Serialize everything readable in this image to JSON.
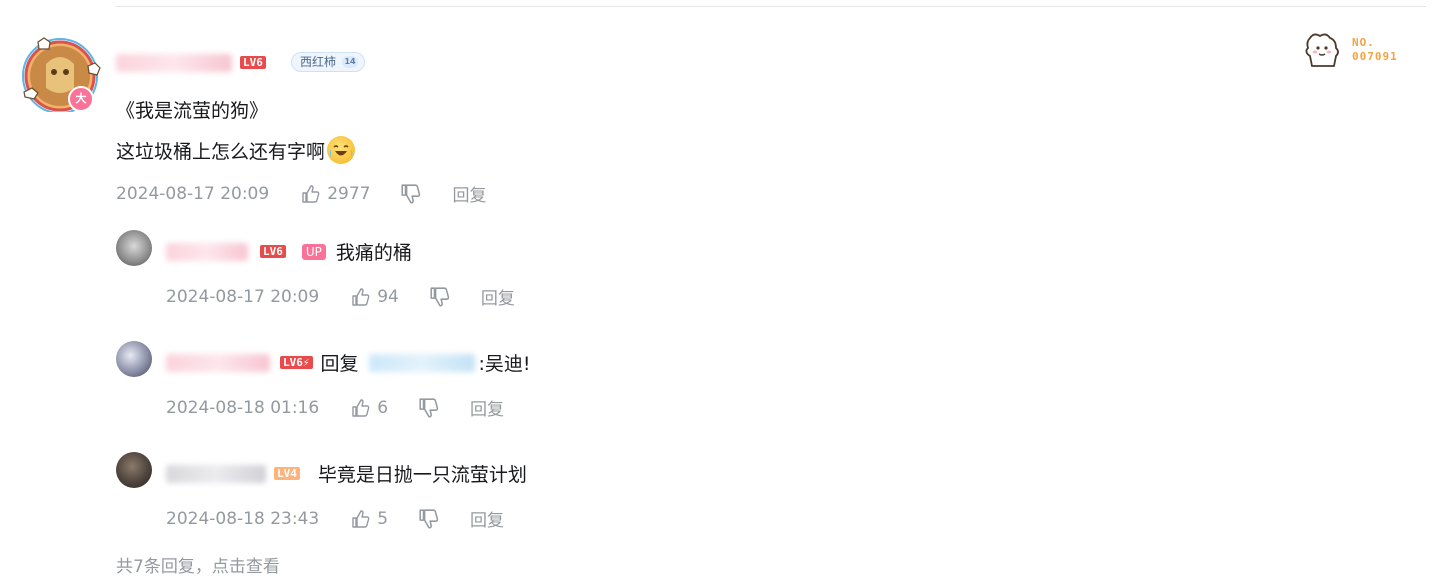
{
  "main_comment": {
    "user_level": "LV6",
    "fan_medal": {
      "name": "西红柿",
      "level": "14"
    },
    "avatar_badge": "大",
    "content_line1": "《我是流萤的狗》",
    "content_line2": "这垃圾桶上怎么还有字啊",
    "date": "2024-08-17 20:09",
    "likes": "2977",
    "reply_label": "回复"
  },
  "no_badge": {
    "line1": "NO.",
    "line2": "007091"
  },
  "replies": [
    {
      "level": "LV6",
      "up_badge": "UP",
      "text": "我痛的桶",
      "date": "2024-08-17 20:09",
      "likes": "94",
      "reply_label": "回复"
    },
    {
      "level": "LV6⚡",
      "reply_prefix": "回复",
      "text": ":吴迪!",
      "date": "2024-08-18 01:16",
      "likes": "6",
      "reply_label": "回复"
    },
    {
      "level": "LV4",
      "text": "毕竟是日抛一只流萤计划",
      "date": "2024-08-18 23:43",
      "likes": "5",
      "reply_label": "回复"
    }
  ],
  "more_replies": "共7条回复，点击查看",
  "colors": {
    "accent_pink": "#fb7299",
    "meta_gray": "#9499a0",
    "lv6": "#ee672a",
    "lv4": "#ffb37c"
  }
}
